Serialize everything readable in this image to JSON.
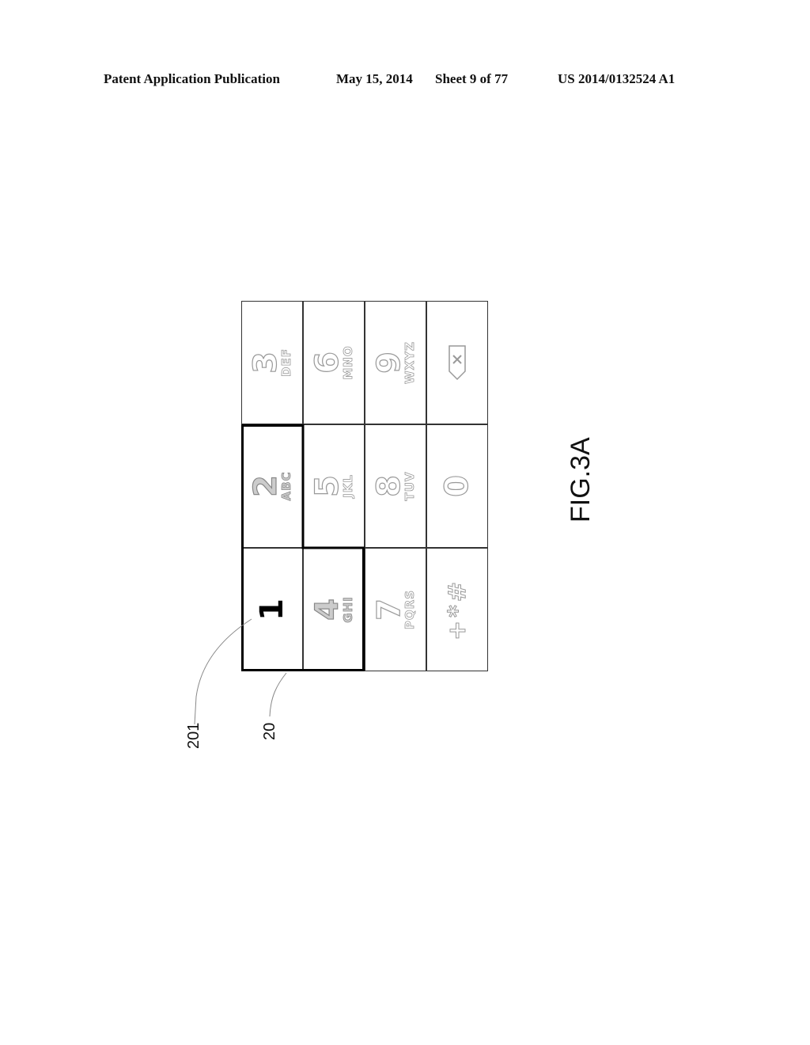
{
  "header": {
    "publication": "Patent Application Publication",
    "date": "May 15, 2014",
    "sheet": "Sheet 9 of 77",
    "number": "US 2014/0132524 A1"
  },
  "keypad": {
    "keys": [
      {
        "num": "1",
        "letters": "",
        "style": "solid"
      },
      {
        "num": "2",
        "letters": "ABC",
        "style": "hatch"
      },
      {
        "num": "3",
        "letters": "DEF",
        "style": "outline"
      },
      {
        "num": "4",
        "letters": "GHI",
        "style": "hatch"
      },
      {
        "num": "5",
        "letters": "JKL",
        "style": "outline"
      },
      {
        "num": "6",
        "letters": "MNO",
        "style": "outline"
      },
      {
        "num": "7",
        "letters": "PQRS",
        "style": "outline"
      },
      {
        "num": "8",
        "letters": "TUV",
        "style": "outline"
      },
      {
        "num": "9",
        "letters": "WXYZ",
        "style": "outline"
      },
      {
        "num": "+*#",
        "letters": "",
        "style": "outline"
      },
      {
        "num": "0",
        "letters": "",
        "style": "outline"
      },
      {
        "num": "",
        "letters": "",
        "style": "outline",
        "icon": "backspace-icon"
      }
    ],
    "highlighted_keys": [
      "1",
      "2",
      "4"
    ],
    "selected_key": "1"
  },
  "labels": {
    "ref_201": "201",
    "ref_20": "20",
    "figure": "FIG.3A"
  }
}
